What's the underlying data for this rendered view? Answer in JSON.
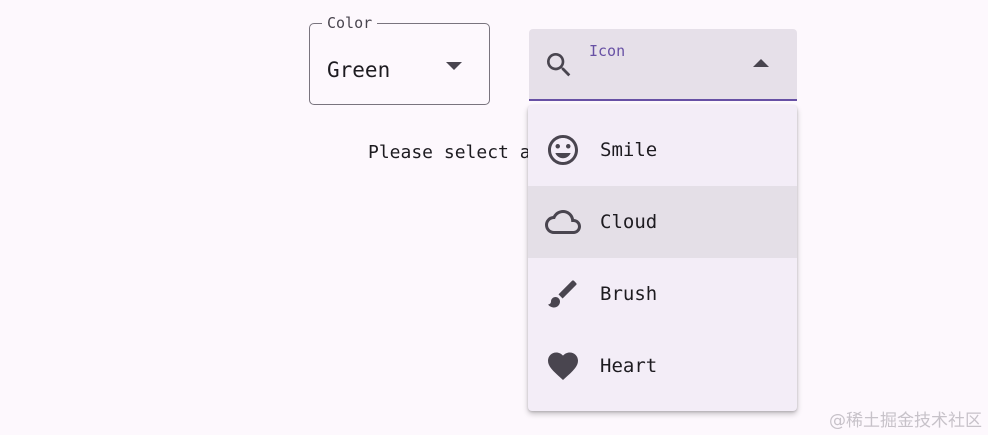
{
  "color_dropdown": {
    "label": "Color",
    "value": "Green"
  },
  "helper_text": "Please select a",
  "icon_dropdown": {
    "label": "Icon",
    "leading_icon": "search-icon"
  },
  "menu": {
    "items": [
      {
        "label": "Smile",
        "icon": "smile-icon",
        "highlighted": false
      },
      {
        "label": "Cloud",
        "icon": "cloud-icon",
        "highlighted": true
      },
      {
        "label": "Brush",
        "icon": "brush-icon",
        "highlighted": false
      },
      {
        "label": "Heart",
        "icon": "heart-icon",
        "highlighted": false
      }
    ]
  },
  "watermark": "@稀土掘金技术社区",
  "colors": {
    "accent": "#6750a4",
    "surface": "#fdf8fd",
    "menu_surface": "#f3edf7",
    "filled_field": "#e6e0e9",
    "highlight": "#e4dfe7",
    "icon": "#49454f"
  }
}
